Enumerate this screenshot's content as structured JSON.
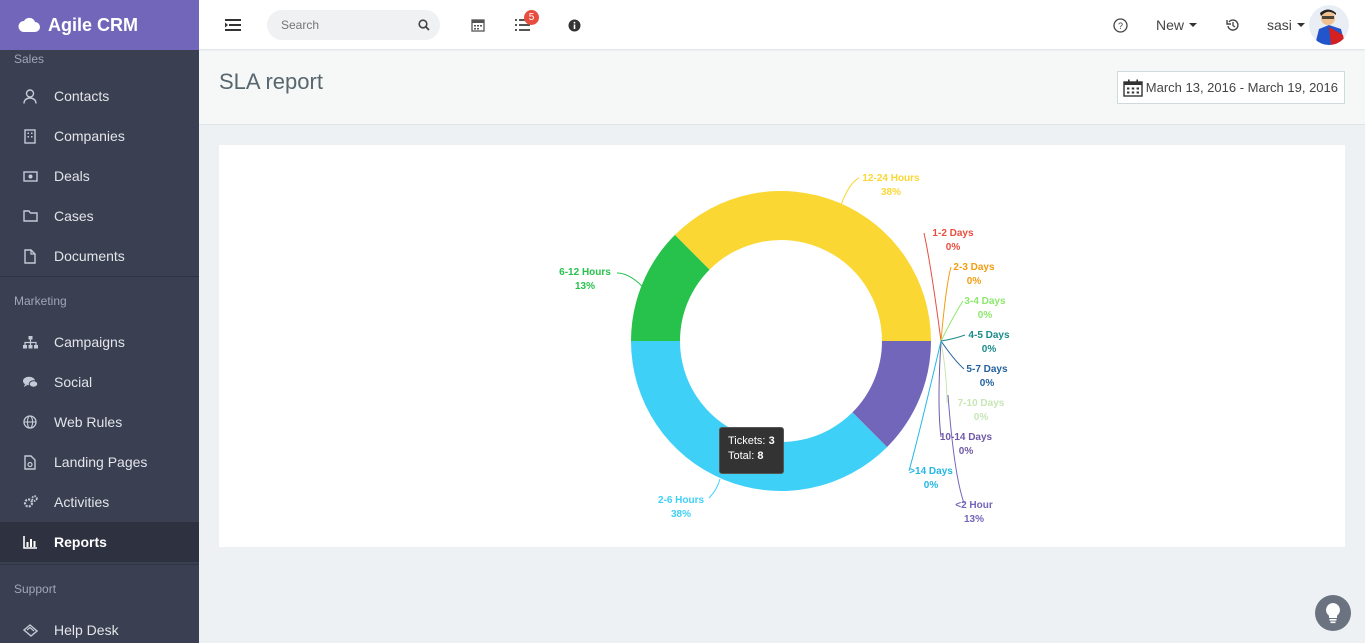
{
  "app": {
    "name": "Agile CRM"
  },
  "sidebar": {
    "sections": [
      {
        "title": "Sales",
        "items": [
          {
            "label": "Contacts",
            "icon": "user-icon"
          },
          {
            "label": "Companies",
            "icon": "building-icon"
          },
          {
            "label": "Deals",
            "icon": "money-icon"
          },
          {
            "label": "Cases",
            "icon": "folder-icon"
          },
          {
            "label": "Documents",
            "icon": "document-icon"
          }
        ]
      },
      {
        "title": "Marketing",
        "items": [
          {
            "label": "Campaigns",
            "icon": "sitemap-icon"
          },
          {
            "label": "Social",
            "icon": "comments-icon"
          },
          {
            "label": "Web Rules",
            "icon": "globe-icon"
          },
          {
            "label": "Landing Pages",
            "icon": "landing-page-icon"
          },
          {
            "label": "Activities",
            "icon": "gears-icon"
          },
          {
            "label": "Reports",
            "icon": "bar-chart-icon",
            "active": true
          }
        ]
      },
      {
        "title": "Support",
        "items": [
          {
            "label": "Help Desk",
            "icon": "ticket-icon"
          }
        ]
      }
    ]
  },
  "header": {
    "search_placeholder": "Search",
    "notifications_count": "5",
    "new_label": "New",
    "user_name": "sasi"
  },
  "page": {
    "title": "SLA report",
    "date_range": "March 13, 2016 - March 19, 2016"
  },
  "tooltip": {
    "tickets_label": "Tickets:",
    "tickets_value": "3",
    "total_label": "Total:",
    "total_value": "8"
  },
  "colors": {
    "accent": "#7266ba",
    "sidebar": "#3a3f51"
  },
  "chart_data": {
    "type": "pie",
    "variant": "donut",
    "total": 8,
    "slices": [
      {
        "name": "<2 Hour",
        "percent": "13%",
        "value": 1,
        "color": "#7266ba"
      },
      {
        "name": "2-6 Hours",
        "percent": "38%",
        "value": 3,
        "color": "#3fd0f8"
      },
      {
        "name": "6-12 Hours",
        "percent": "13%",
        "value": 1,
        "color": "#27c24c"
      },
      {
        "name": "12-24 Hours",
        "percent": "38%",
        "value": 3,
        "color": "#fad733"
      },
      {
        "name": "1-2 Days",
        "percent": "0%",
        "value": 0,
        "color": "#e84e40"
      },
      {
        "name": "2-3 Days",
        "percent": "0%",
        "value": 0,
        "color": "#f39c12"
      },
      {
        "name": "3-4 Days",
        "percent": "0%",
        "value": 0,
        "color": "#8ce86c"
      },
      {
        "name": "4-5 Days",
        "percent": "0%",
        "value": 0,
        "color": "#1a8a8a"
      },
      {
        "name": "5-7 Days",
        "percent": "0%",
        "value": 0,
        "color": "#23629e"
      },
      {
        "name": "7-10 Days",
        "percent": "0%",
        "value": 0,
        "color": "#c8e6b5"
      },
      {
        "name": "10-14 Days",
        "percent": "0%",
        "value": 0,
        "color": "#6f5aa8"
      },
      {
        "name": ">14 Days",
        "percent": "0%",
        "value": 0,
        "color": "#23b7e5"
      }
    ]
  }
}
